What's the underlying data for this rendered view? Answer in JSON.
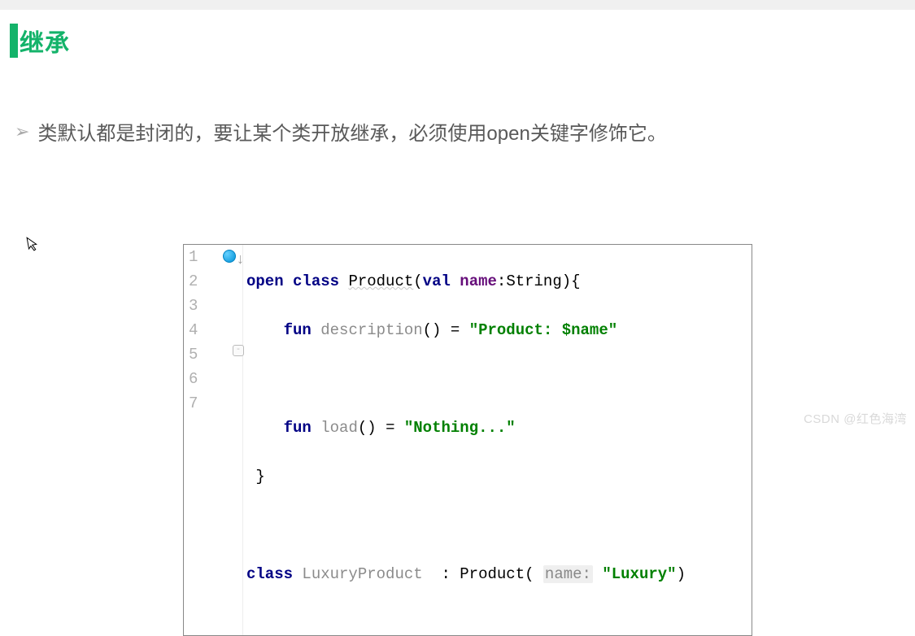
{
  "heading": "继承",
  "bullet": {
    "marker": "➢",
    "text": "类默认都是封闭的，要让某个类开放继承，必须使用open关键字修饰它。"
  },
  "code": {
    "line_numbers": [
      "1",
      "2",
      "3",
      "4",
      "5",
      "6",
      "7"
    ],
    "l1": {
      "kw_open": "open",
      "sp1": " ",
      "kw_class": "class",
      "sp2": " ",
      "type": "Product",
      "lp": "(",
      "kw_val": "val",
      "sp3": " ",
      "field": "name",
      "colon": ":",
      "ptype": "String",
      "rp_brc": "){"
    },
    "l2": {
      "indent": "    ",
      "kw_fun": "fun",
      "sp": " ",
      "fname": "description",
      "parens": "() ",
      "eq": "= ",
      "str": "\"Product: $name\""
    },
    "l3": {
      "content": ""
    },
    "l4": {
      "indent": "    ",
      "kw_fun": "fun",
      "sp": " ",
      "fname": "load",
      "parens": "() ",
      "eq": "= ",
      "str": "\"Nothing...\""
    },
    "l5": {
      "brace": " }"
    },
    "l6": {
      "content": ""
    },
    "l7": {
      "kw_class": "class",
      "sp": " ",
      "cname": "LuxuryProduct",
      "spc": "  ",
      "colon": ": ",
      "super": "Product",
      "lp": "( ",
      "hint": "name:",
      "sp2": " ",
      "str": "\"Luxury\"",
      "rp": ")"
    }
  },
  "cursor_glyph": "↖",
  "watermark": "CSDN @红色海湾"
}
